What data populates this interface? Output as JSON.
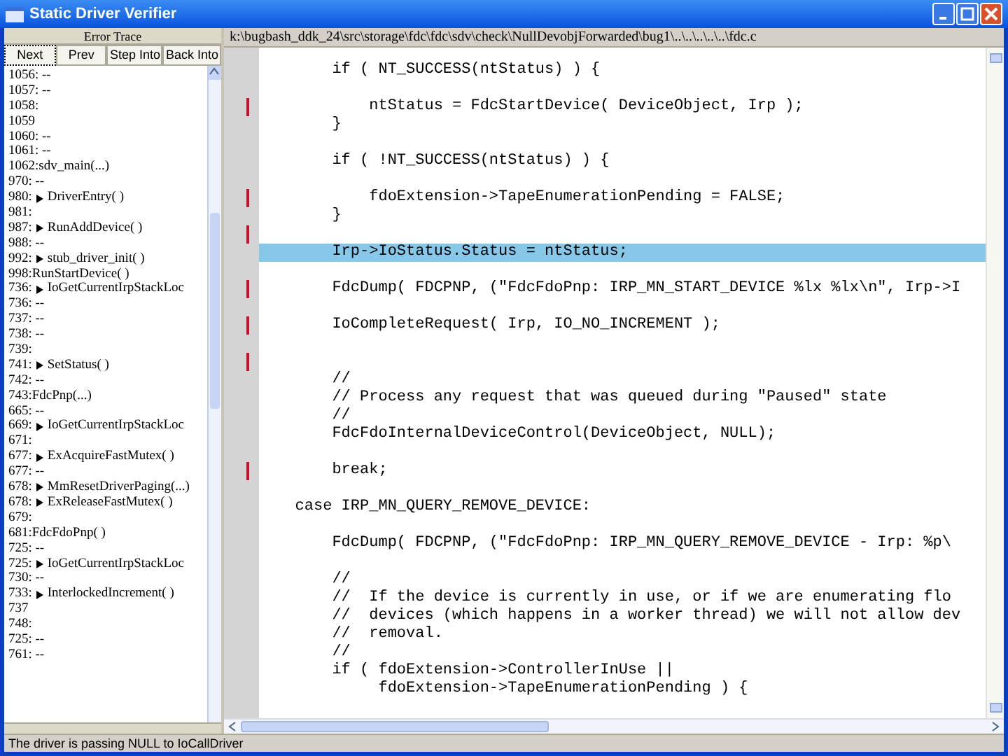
{
  "window": {
    "title": "Static Driver Verifier"
  },
  "error_trace": {
    "title": "Error Trace",
    "buttons": [
      {
        "label": "Next",
        "selected": true
      },
      {
        "label": "Prev",
        "selected": false
      },
      {
        "label": "Step Into",
        "selected": false
      },
      {
        "label": "Back Into",
        "selected": false
      }
    ],
    "items": [
      {
        "text": "1056: --",
        "call": false
      },
      {
        "text": "1057: --",
        "call": false
      },
      {
        "text": "1058:",
        "call": false
      },
      {
        "text": "1059",
        "call": false
      },
      {
        "text": "1060: --",
        "call": false
      },
      {
        "text": "1061: --",
        "call": false
      },
      {
        "text": "1062:sdv_main(...)",
        "call": false
      },
      {
        "text": "970: --",
        "call": false
      },
      {
        "text": "980:",
        "label": "DriverEntry( )",
        "call": true
      },
      {
        "text": "981:",
        "call": false
      },
      {
        "text": "987:",
        "label": "RunAddDevice( )",
        "call": true
      },
      {
        "text": "988: --",
        "call": false
      },
      {
        "text": "992:",
        "label": "stub_driver_init( )",
        "call": true
      },
      {
        "text": "998:RunStartDevice( )",
        "call": false
      },
      {
        "text": "736:",
        "label": "IoGetCurrentIrpStackLoc",
        "call": true
      },
      {
        "text": "736: --",
        "call": false
      },
      {
        "text": "737: --",
        "call": false
      },
      {
        "text": "738: --",
        "call": false
      },
      {
        "text": "739:",
        "call": false
      },
      {
        "text": "741:",
        "label": "SetStatus( )",
        "call": true
      },
      {
        "text": "742: --",
        "call": false
      },
      {
        "text": "743:FdcPnp(...)",
        "call": false
      },
      {
        "text": "665: --",
        "call": false
      },
      {
        "text": "669:",
        "label": "IoGetCurrentIrpStackLoc",
        "call": true
      },
      {
        "text": "671:",
        "call": false
      },
      {
        "text": "677:",
        "label": "ExAcquireFastMutex( )",
        "call": true
      },
      {
        "text": "677: --",
        "call": false
      },
      {
        "text": "678:",
        "label": "MmResetDriverPaging(...)",
        "call": true
      },
      {
        "text": "678:",
        "label": "ExReleaseFastMutex( )",
        "call": true
      },
      {
        "text": "679:",
        "call": false
      },
      {
        "text": "681:FdcFdoPnp( )",
        "call": false
      },
      {
        "text": "725: --",
        "call": false
      },
      {
        "text": "725:",
        "label": "IoGetCurrentIrpStackLoc",
        "call": true
      },
      {
        "text": "730: --",
        "call": false
      },
      {
        "text": "733:",
        "label": "InterlockedIncrement( )",
        "call": true
      },
      {
        "text": "737",
        "call": false
      },
      {
        "text": "748:",
        "call": false
      },
      {
        "text": "725: --",
        "call": false
      },
      {
        "text": "761: --",
        "call": false
      }
    ]
  },
  "source": {
    "path": "k:\\bugbash_ddk_24\\src\\storage\\fdc\\fdc\\sdv\\check\\NullDevobjForwarded\\bug1\\..\\..\\..\\..\\..\\fdc.c",
    "lines": [
      {
        "kind": "code",
        "text": "       if ( NT_SUCCESS(ntStatus) ) {",
        "selected": false,
        "marker": false
      },
      {
        "kind": "blank"
      },
      {
        "kind": "code",
        "text": "           ntStatus = FdcStartDevice( DeviceObject, Irp );",
        "selected": false,
        "marker": true
      },
      {
        "kind": "code",
        "text": "       }",
        "selected": false,
        "marker": false
      },
      {
        "kind": "blank"
      },
      {
        "kind": "code",
        "text": "       if ( !NT_SUCCESS(ntStatus) ) {",
        "selected": false,
        "marker": false
      },
      {
        "kind": "blank"
      },
      {
        "kind": "code",
        "text": "           fdoExtension->TapeEnumerationPending = FALSE;",
        "selected": false,
        "marker": true
      },
      {
        "kind": "code",
        "text": "       }",
        "selected": false,
        "marker": false
      },
      {
        "kind": "blank",
        "marker": true
      },
      {
        "kind": "code",
        "text": "       Irp->IoStatus.Status = ntStatus;",
        "selected": true,
        "marker": false
      },
      {
        "kind": "blank"
      },
      {
        "kind": "code",
        "text": "       FdcDump( FDCPNP, (\"FdcFdoPnp: IRP_MN_START_DEVICE %lx %lx\\n\", Irp->I",
        "selected": false,
        "marker": true
      },
      {
        "kind": "blank"
      },
      {
        "kind": "code",
        "text": "       IoCompleteRequest( Irp, IO_NO_INCREMENT );",
        "selected": false,
        "marker": true
      },
      {
        "kind": "blank"
      },
      {
        "kind": "blank",
        "marker": true
      },
      {
        "kind": "code",
        "text": "       //",
        "selected": false,
        "marker": false
      },
      {
        "kind": "code",
        "text": "       // Process any request that was queued during \"Paused\" state",
        "selected": false,
        "marker": false
      },
      {
        "kind": "code",
        "text": "       //",
        "selected": false,
        "marker": false
      },
      {
        "kind": "code",
        "text": "       FdcFdoInternalDeviceControl(DeviceObject, NULL);",
        "selected": false,
        "marker": false
      },
      {
        "kind": "blank"
      },
      {
        "kind": "code",
        "text": "       break;",
        "selected": false,
        "marker": true
      },
      {
        "kind": "blank"
      },
      {
        "kind": "code",
        "text": "   case IRP_MN_QUERY_REMOVE_DEVICE:",
        "selected": false,
        "marker": false
      },
      {
        "kind": "blank"
      },
      {
        "kind": "code",
        "text": "       FdcDump( FDCPNP, (\"FdcFdoPnp: IRP_MN_QUERY_REMOVE_DEVICE - Irp: %p\\",
        "selected": false,
        "marker": false
      },
      {
        "kind": "blank"
      },
      {
        "kind": "code",
        "text": "       //",
        "selected": false,
        "marker": false
      },
      {
        "kind": "code",
        "text": "       //  If the device is currently in use, or if we are enumerating flo",
        "selected": false,
        "marker": false
      },
      {
        "kind": "code",
        "text": "       //  devices (which happens in a worker thread) we will not allow dev",
        "selected": false,
        "marker": false
      },
      {
        "kind": "code",
        "text": "       //  removal.",
        "selected": false,
        "marker": false
      },
      {
        "kind": "code",
        "text": "       //",
        "selected": false,
        "marker": false
      },
      {
        "kind": "code",
        "text": "       if ( fdoExtension->ControllerInUse ||",
        "selected": false,
        "marker": false
      },
      {
        "kind": "code",
        "text": "            fdoExtension->TapeEnumerationPending ) {",
        "selected": false,
        "marker": false
      }
    ]
  },
  "status_bar": {
    "text": "The driver is passing NULL to IoCallDriver"
  }
}
